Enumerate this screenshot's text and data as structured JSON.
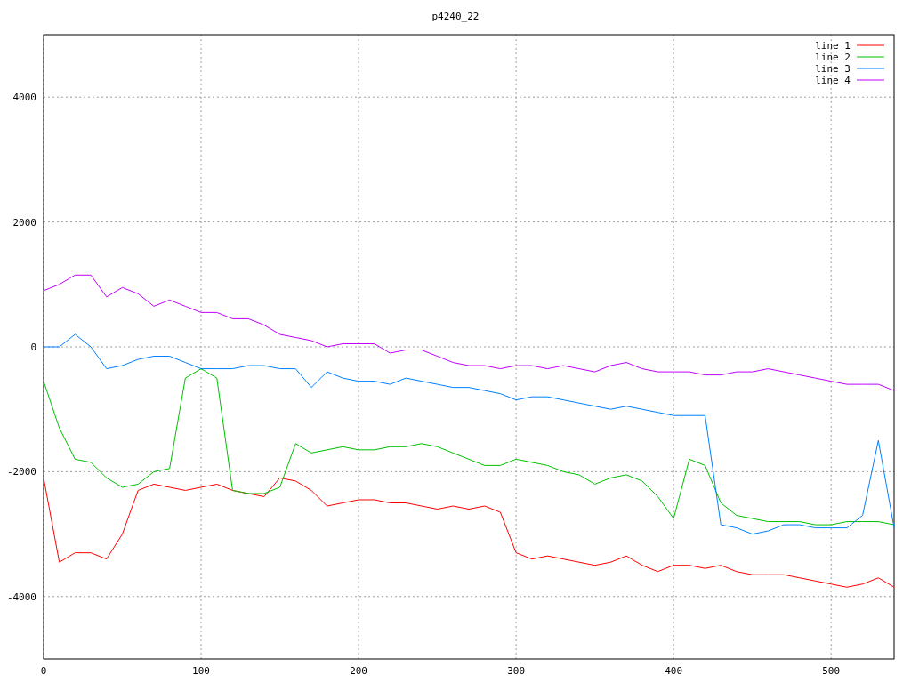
{
  "chart_data": {
    "type": "line",
    "title": "p4240_22",
    "xlim": [
      0,
      540
    ],
    "ylim": [
      -5000,
      5000
    ],
    "xticks": [
      0,
      100,
      200,
      300,
      400,
      500
    ],
    "yticks": [
      -4000,
      -2000,
      0,
      2000,
      4000
    ],
    "grid": true,
    "legend": true,
    "x": [
      0,
      10,
      20,
      30,
      40,
      50,
      60,
      70,
      80,
      90,
      100,
      110,
      120,
      130,
      140,
      150,
      160,
      170,
      180,
      190,
      200,
      210,
      220,
      230,
      240,
      250,
      260,
      270,
      280,
      290,
      300,
      310,
      320,
      330,
      340,
      350,
      360,
      370,
      380,
      390,
      400,
      410,
      420,
      430,
      440,
      450,
      460,
      470,
      480,
      490,
      500,
      510,
      520,
      530,
      540
    ],
    "series": [
      {
        "name": "line 1",
        "color": "#ff0000",
        "values": [
          -2100,
          -3450,
          -3300,
          -3300,
          -3400,
          -3000,
          -2300,
          -2200,
          -2250,
          -2300,
          -2250,
          -2200,
          -2300,
          -2350,
          -2400,
          -2100,
          -2150,
          -2300,
          -2550,
          -2500,
          -2450,
          -2450,
          -2500,
          -2500,
          -2550,
          -2600,
          -2550,
          -2600,
          -2550,
          -2650,
          -3300,
          -3400,
          -3350,
          -3400,
          -3450,
          -3500,
          -3450,
          -3350,
          -3500,
          -3600,
          -3500,
          -3500,
          -3550,
          -3500,
          -3600,
          -3650,
          -3650,
          -3650,
          -3700,
          -3750,
          -3800,
          -3850,
          -3800,
          -3700,
          -3850
        ]
      },
      {
        "name": "line 2",
        "color": "#00c000",
        "values": [
          -550,
          -1300,
          -1800,
          -1850,
          -2100,
          -2250,
          -2200,
          -2000,
          -1950,
          -500,
          -350,
          -500,
          -2300,
          -2350,
          -2350,
          -2250,
          -1550,
          -1700,
          -1650,
          -1600,
          -1650,
          -1650,
          -1600,
          -1600,
          -1550,
          -1600,
          -1700,
          -1800,
          -1900,
          -1900,
          -1800,
          -1850,
          -1900,
          -2000,
          -2050,
          -2200,
          -2100,
          -2050,
          -2150,
          -2400,
          -2750,
          -1800,
          -1900,
          -2500,
          -2700,
          -2750,
          -2800,
          -2800,
          -2800,
          -2850,
          -2850,
          -2800,
          -2800,
          -2800,
          -2850
        ]
      },
      {
        "name": "line 3",
        "color": "#0080ff",
        "values": [
          0,
          0,
          200,
          0,
          -350,
          -300,
          -200,
          -150,
          -150,
          -250,
          -350,
          -350,
          -350,
          -300,
          -300,
          -350,
          -350,
          -650,
          -400,
          -500,
          -550,
          -550,
          -600,
          -500,
          -550,
          -600,
          -650,
          -650,
          -700,
          -750,
          -850,
          -800,
          -800,
          -850,
          -900,
          -950,
          -1000,
          -950,
          -1000,
          -1050,
          -1100,
          -1100,
          -1100,
          -2850,
          -2900,
          -3000,
          -2950,
          -2850,
          -2850,
          -2900,
          -2900,
          -2900,
          -2700,
          -1500,
          -2900
        ]
      },
      {
        "name": "line 4",
        "color": "#c000ff",
        "values": [
          900,
          1000,
          1150,
          1150,
          800,
          950,
          850,
          650,
          750,
          650,
          550,
          550,
          450,
          450,
          350,
          200,
          150,
          100,
          0,
          50,
          50,
          50,
          -100,
          -50,
          -50,
          -150,
          -250,
          -300,
          -300,
          -350,
          -300,
          -300,
          -350,
          -300,
          -350,
          -400,
          -300,
          -250,
          -350,
          -400,
          -400,
          -400,
          -450,
          -450,
          -400,
          -400,
          -350,
          -400,
          -450,
          -500,
          -550,
          -600,
          -600,
          -600,
          -700
        ]
      }
    ]
  }
}
